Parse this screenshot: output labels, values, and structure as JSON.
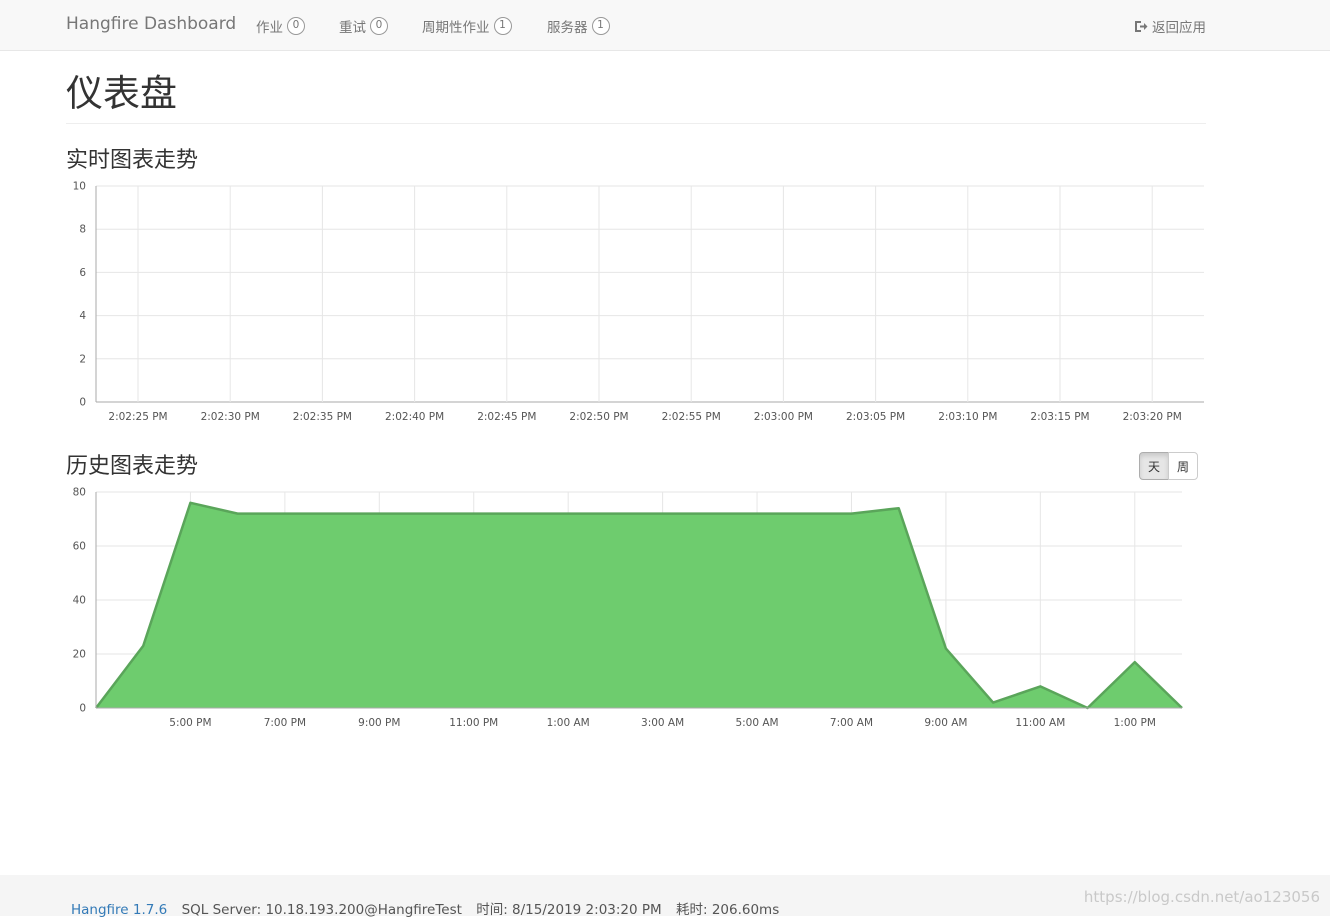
{
  "navbar": {
    "brand": "Hangfire Dashboard",
    "items": [
      {
        "label": "作业",
        "count": "0"
      },
      {
        "label": "重试",
        "count": "0"
      },
      {
        "label": "周期性作业",
        "count": "1"
      },
      {
        "label": "服务器",
        "count": "1"
      }
    ],
    "back_label": "返回应用",
    "back_icon": "sign-out-icon"
  },
  "page": {
    "title": "仪表盘",
    "realtime_heading": "实时图表走势",
    "history_heading": "历史图表走势"
  },
  "history_toggle": {
    "day_label": "天",
    "week_label": "周",
    "selected": "天"
  },
  "chart_data": [
    {
      "type": "line",
      "title": "实时图表走势",
      "categories": [
        "2:02:25 PM",
        "2:02:30 PM",
        "2:02:35 PM",
        "2:02:40 PM",
        "2:02:45 PM",
        "2:02:50 PM",
        "2:02:55 PM",
        "2:03:00 PM",
        "2:03:05 PM",
        "2:03:10 PM",
        "2:03:15 PM",
        "2:03:20 PM"
      ],
      "yticks": [
        "0",
        "2",
        "4",
        "6",
        "8",
        "10"
      ],
      "ylim": [
        0,
        10
      ],
      "series": [],
      "grid": true
    },
    {
      "type": "area",
      "title": "历史图表走势",
      "xticks": [
        "5:00 PM",
        "7:00 PM",
        "9:00 PM",
        "11:00 PM",
        "1:00 AM",
        "3:00 AM",
        "5:00 AM",
        "7:00 AM",
        "9:00 AM",
        "11:00 AM",
        "1:00 PM"
      ],
      "yticks": [
        "0",
        "20",
        "40",
        "60",
        "80"
      ],
      "ylim": [
        0,
        80
      ],
      "series": [
        {
          "color": "#6ecc6e",
          "x_hours": [
            0,
            1,
            2,
            3,
            4,
            5,
            6,
            7,
            8,
            9,
            10,
            11,
            12,
            13,
            14,
            15,
            16,
            17,
            18,
            19,
            20,
            21,
            22,
            23
          ],
          "values": [
            0,
            23,
            76,
            72,
            72,
            72,
            72,
            72,
            72,
            72,
            72,
            72,
            72,
            72,
            72,
            72,
            72,
            74,
            22,
            2,
            8,
            0,
            17,
            0
          ]
        }
      ],
      "grid": true
    }
  ],
  "footer": {
    "version": "Hangfire 1.7.6",
    "storage": "SQL Server: 10.18.193.200@HangfireTest",
    "time": "时间: 8/15/2019 2:03:20 PM",
    "elapsed": "耗时: 206.60ms",
    "watermark": "https://blog.csdn.net/ao123056"
  }
}
